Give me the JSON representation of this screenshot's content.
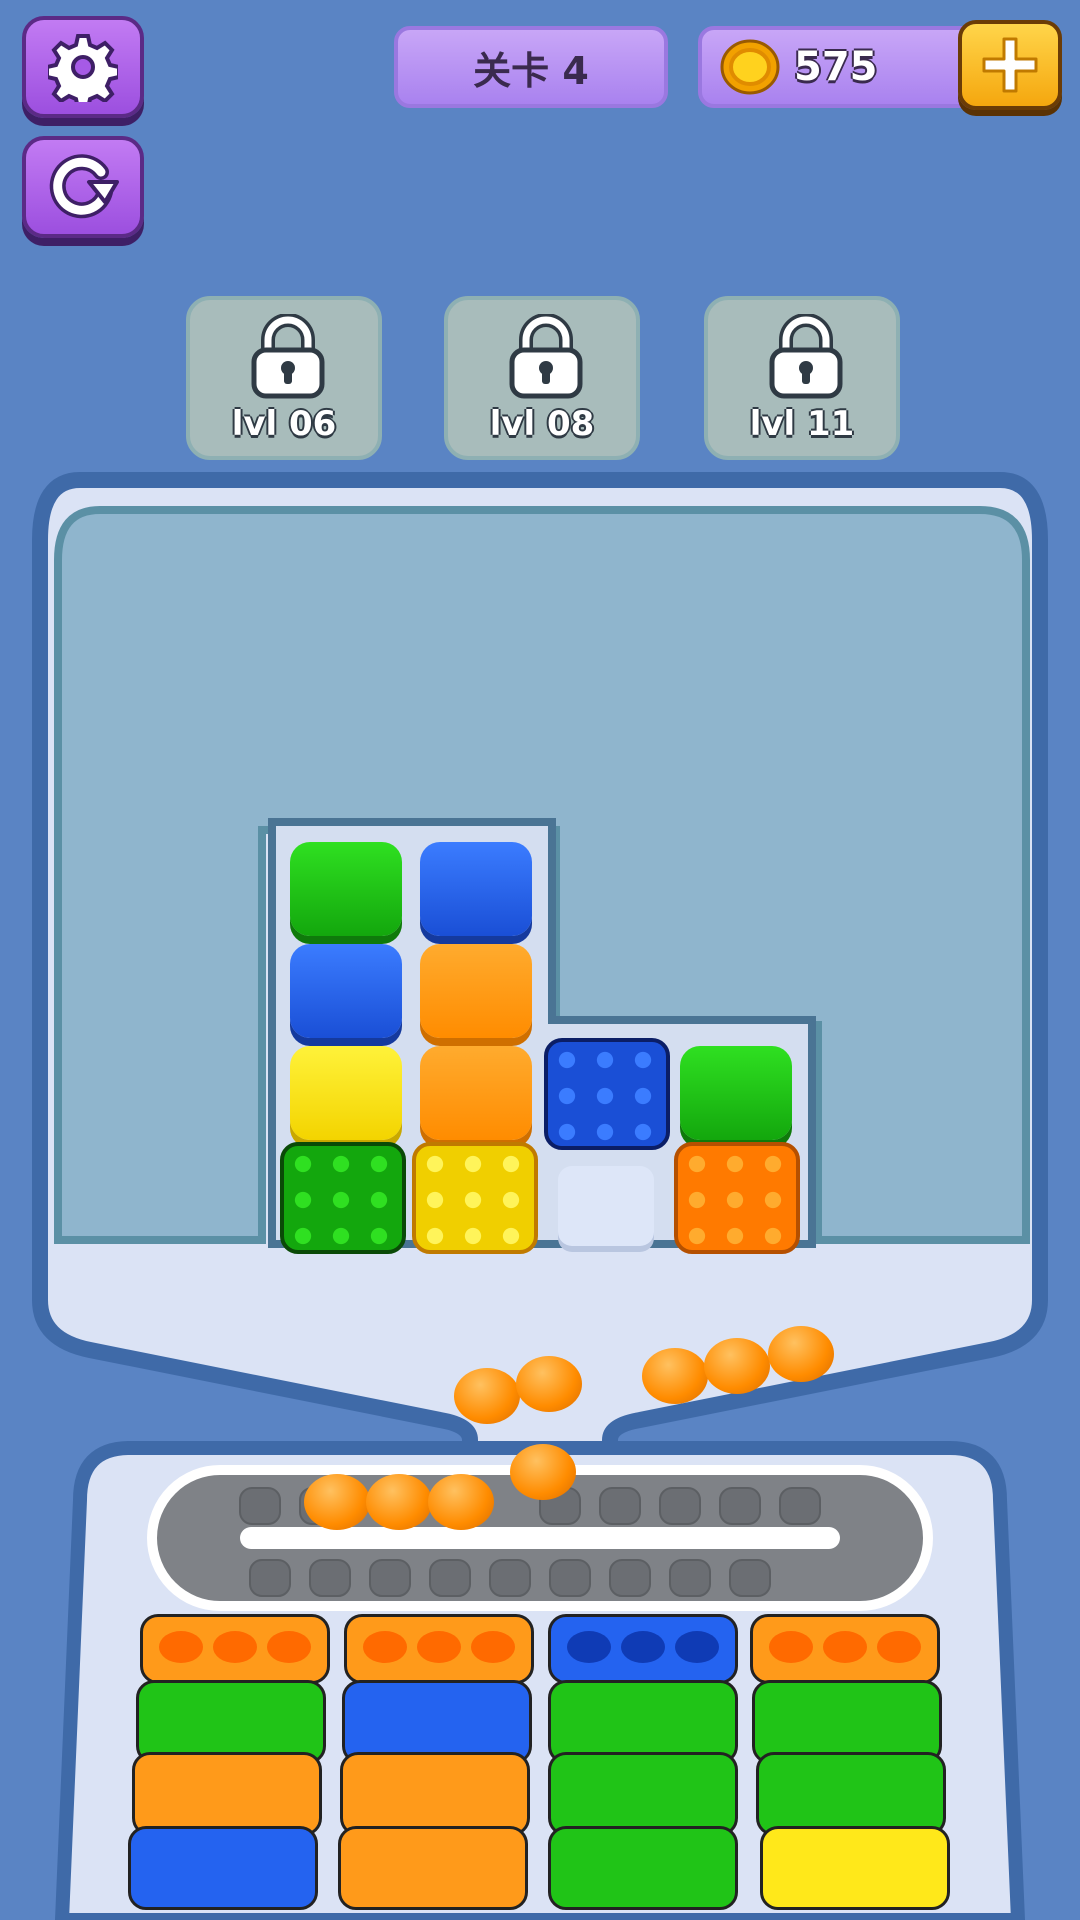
{
  "header": {
    "level_label": "关卡 4",
    "coins": "575"
  },
  "icons": {
    "settings": "gear-icon",
    "restart": "restart-icon",
    "coin": "coin-icon",
    "add": "plus-icon",
    "lock": "lock-icon"
  },
  "locked_slots": [
    {
      "label": "lvl 06"
    },
    {
      "label": "lvl 08"
    },
    {
      "label": "lvl 11"
    }
  ],
  "colors": {
    "green": "#17c80f",
    "blue": "#1f5ef0",
    "orange": "#ff9500",
    "yellow": "#ffe600",
    "empty": "#dde6f8"
  },
  "board_tiles": [
    "green",
    "blue",
    "blue",
    "orange",
    "yellow",
    "orange",
    "blue-bubble",
    "green",
    "green-bubble",
    "yellow-bubble",
    "empty",
    "orange-bubble"
  ],
  "conveyor_balls": 3,
  "falling_balls": 6,
  "columns": [
    {
      "top": "orange",
      "blocks": [
        "green",
        "orange",
        "blue"
      ]
    },
    {
      "top": "orange",
      "blocks": [
        "blue",
        "orange",
        "orange"
      ]
    },
    {
      "top": "blue",
      "blocks": [
        "green",
        "green",
        "green"
      ]
    },
    {
      "top": "orange",
      "blocks": [
        "green",
        "green",
        "yellow"
      ]
    }
  ]
}
